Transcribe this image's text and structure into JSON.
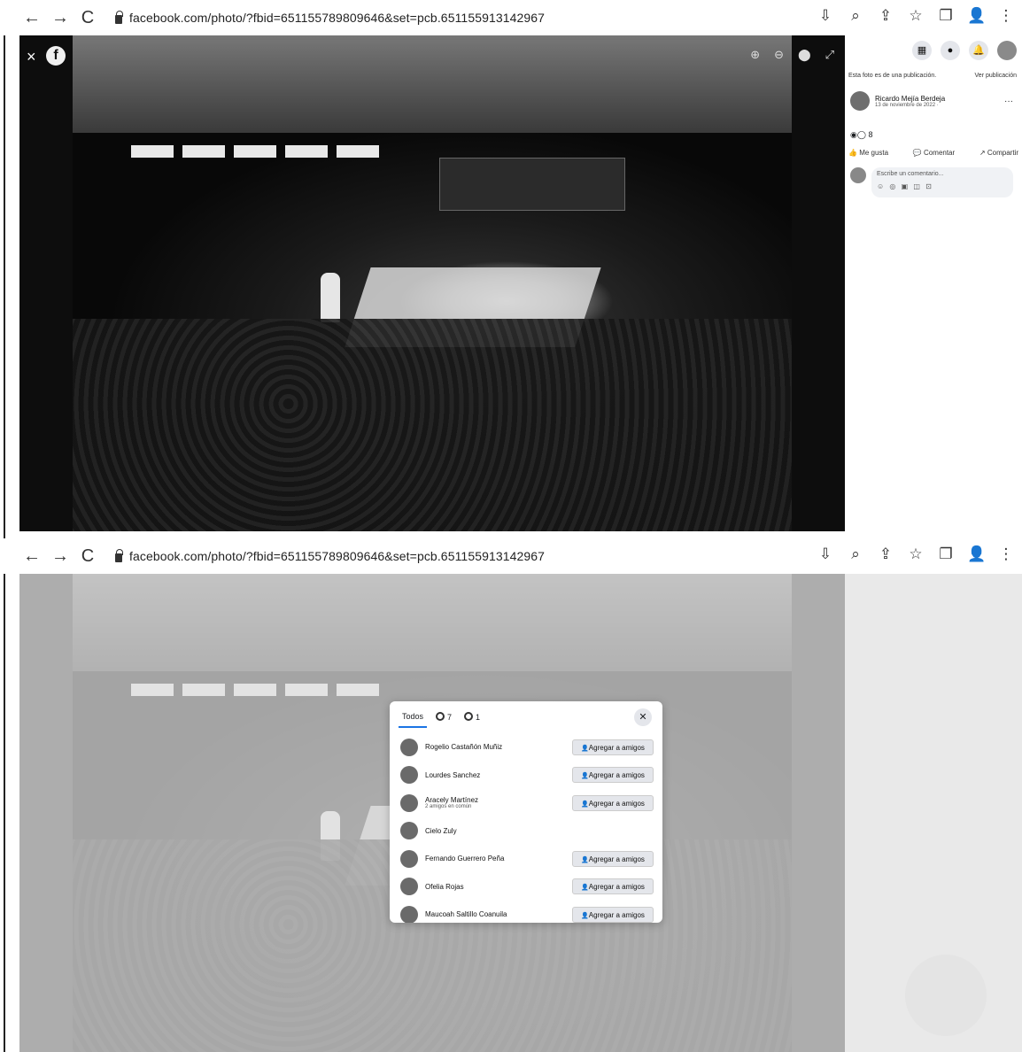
{
  "screenshots": [
    {
      "browser": {
        "url": "facebook.com/photo/?fbid=651155789809646&set=pcb.651155913142967"
      },
      "viewer": {
        "close_glyph": "×",
        "logo_glyph": "f"
      },
      "panel": {
        "notice_text": "Esta foto es de una publicación.",
        "view_post_link": "Ver publicación",
        "author_name": "Ricardo Mejía Berdeja",
        "post_date": "13 de noviembre de 2022 ·",
        "more_glyph": "···",
        "reaction_count": "8",
        "like_label": "Me gusta",
        "comment_label": "Comentar",
        "share_label": "Compartir",
        "comment_placeholder": "Escribe un comentario..."
      }
    },
    {
      "browser": {
        "url": "facebook.com/photo/?fbid=651155789809646&set=pcb.651155913142967"
      }
    }
  ],
  "reactions_dialog": {
    "tab_all": "Todos",
    "tab_like_count": "7",
    "tab_love_count": "1",
    "close_glyph": "✕",
    "people": [
      {
        "name": "Rogelio Castañón Muñiz",
        "subtitle": "",
        "button": "Agregar a amigos"
      },
      {
        "name": "Lourdes Sanchez",
        "subtitle": "",
        "button": "Agregar a amigos"
      },
      {
        "name": "Aracely Martínez",
        "subtitle": "2 amigos en común",
        "button": "Agregar a amigos"
      },
      {
        "name": "Cielo Zuly",
        "subtitle": "",
        "button": ""
      },
      {
        "name": "Fernando Guerrero Peña",
        "subtitle": "",
        "button": "Agregar a amigos"
      },
      {
        "name": "Ofelia Rojas",
        "subtitle": "",
        "button": "Agregar a amigos"
      },
      {
        "name": "Maucoah Saltillo Coanuila",
        "subtitle": "",
        "button": "Agregar a amigos"
      }
    ]
  },
  "icons": {
    "back": "←",
    "forward": "→",
    "reload": "C",
    "chrome_right": [
      "⇩",
      "⌕",
      "⇪",
      "☆",
      "❐",
      "👤",
      "⋮"
    ],
    "viewer_tools": [
      "⊕",
      "⊖",
      "⬤",
      "⤢"
    ],
    "panel_top": [
      "▦",
      "●",
      "🔔"
    ]
  }
}
